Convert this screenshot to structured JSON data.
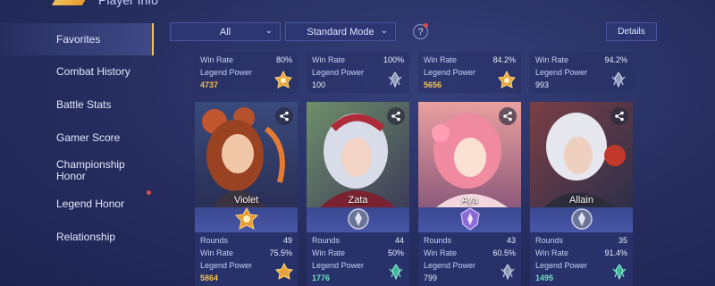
{
  "header": {
    "title": "Player Info"
  },
  "sidebar": {
    "items": [
      {
        "label": "Favorites",
        "active": true
      },
      {
        "label": "Combat History"
      },
      {
        "label": "Battle Stats"
      },
      {
        "label": "Gamer Score"
      },
      {
        "label": "Championship Honor"
      },
      {
        "label": "Legend Honor"
      },
      {
        "label": "Relationship"
      }
    ]
  },
  "filters": {
    "all": "All",
    "mode": "Standard Mode",
    "help": "?",
    "details": "Details"
  },
  "labels": {
    "win_rate": "Win Rate",
    "legend_power": "Legend Power",
    "rounds": "Rounds"
  },
  "top_stats": [
    {
      "win_rate": "80%",
      "legend_power": "4737",
      "power_color": "#f3c24f",
      "emblem": "gold-legend-emblem-icon"
    },
    {
      "win_rate": "100%",
      "legend_power": "100",
      "power_color": "#e8ecff",
      "emblem": "silver-legend-emblem-icon"
    },
    {
      "win_rate": "84.2%",
      "legend_power": "5656",
      "power_color": "#f3c24f",
      "emblem": "gold-legend-emblem-icon"
    },
    {
      "win_rate": "94.2%",
      "legend_power": "993",
      "power_color": "#e8ecff",
      "emblem": "silver-legend-emblem-icon"
    }
  ],
  "heroes": [
    {
      "name": "Violet",
      "rounds": "49",
      "win_rate": "75.5%",
      "legend_power": "5864",
      "power_color": "#f3c24f",
      "rank": "gold-rank-emblem-icon"
    },
    {
      "name": "Zata",
      "rounds": "44",
      "win_rate": "50%",
      "legend_power": "1776",
      "power_color": "#6fe0c2",
      "rank": "silver-rank-emblem-icon"
    },
    {
      "name": "Aya",
      "rounds": "43",
      "win_rate": "60.5%",
      "legend_power": "799",
      "power_color": "#e8ecff",
      "rank": "purple-rank-emblem-icon"
    },
    {
      "name": "Allain",
      "rounds": "35",
      "win_rate": "91.4%",
      "legend_power": "1495",
      "power_color": "#6fe0c2",
      "rank": "silver-rank-emblem-icon"
    }
  ],
  "colors": {
    "accent": "#f0c35a",
    "background": "#262d5e",
    "notify": "#e24b4b"
  }
}
